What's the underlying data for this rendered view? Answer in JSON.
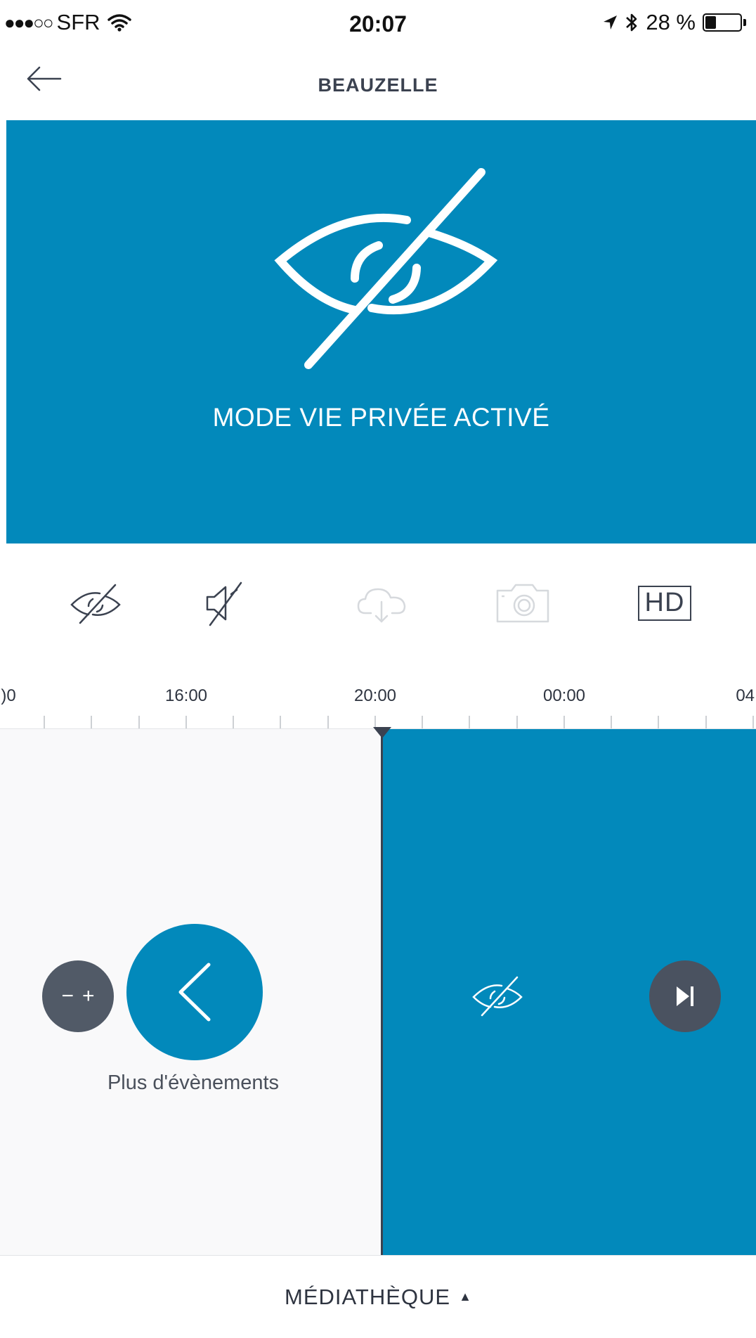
{
  "status_bar": {
    "signal": "●●●○○",
    "carrier": "SFR",
    "time": "20:07",
    "battery": "28 %",
    "battery_level": 0.28
  },
  "nav": {
    "title": "BEAUZELLE",
    "back_icon": "arrow-left-icon"
  },
  "hero": {
    "background_color": "#0289bb",
    "icon": "eye-slash-icon",
    "message": "MODE VIE PRIVÉE ACTIVÉ"
  },
  "toolbar": {
    "items": [
      {
        "name": "privacy-toggle",
        "icon": "eye-slash-icon",
        "enabled": true
      },
      {
        "name": "sound-toggle",
        "icon": "speaker-muted-icon",
        "enabled": true
      },
      {
        "name": "cloud-download",
        "icon": "cloud-download-icon",
        "enabled": false
      },
      {
        "name": "snapshot",
        "icon": "camera-icon",
        "enabled": false
      },
      {
        "name": "hd-toggle",
        "label": "HD",
        "enabled": true
      }
    ]
  },
  "timeline": {
    "labels": [
      ")0",
      "16:00",
      "20:00",
      "00:00",
      "04:"
    ],
    "current_time": "20:07"
  },
  "events": {
    "zoom_minus": "−",
    "zoom_plus": "+",
    "more_label": "Plus d'évènements",
    "accent_color": "#0289bb"
  },
  "bottom_bar": {
    "label": "MÉDIATHÈQUE",
    "arrow": "▲"
  }
}
